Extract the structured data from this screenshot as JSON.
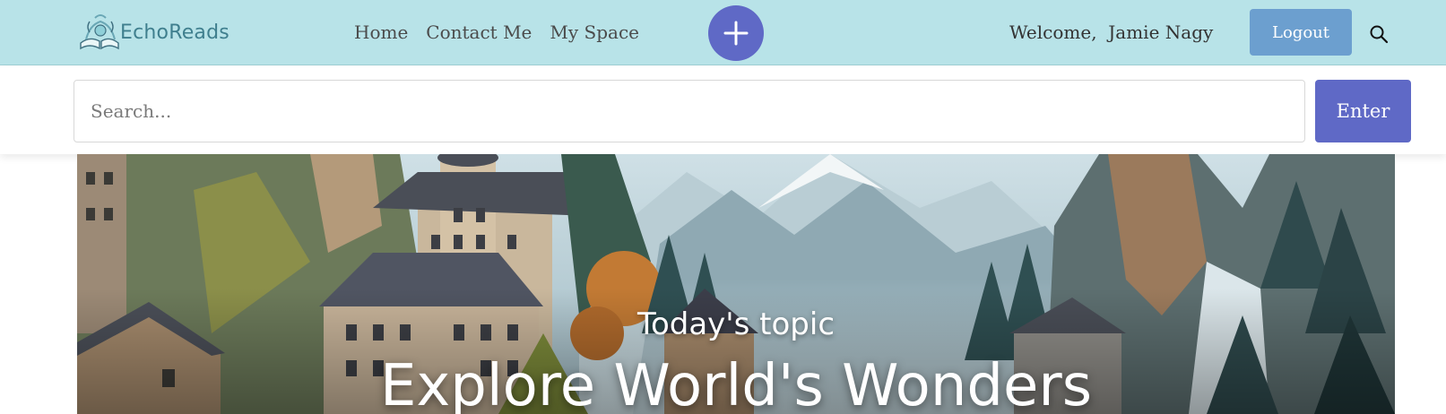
{
  "header": {
    "brand": "EchoReads",
    "nav": [
      {
        "label": "Home"
      },
      {
        "label": "Contact Me"
      },
      {
        "label": "My Space"
      }
    ],
    "add_icon": "plus-icon",
    "welcome_text": "Welcome,  Jamie Nagy",
    "logout_label": "Logout",
    "search_icon": "search-icon"
  },
  "search": {
    "placeholder": "Search...",
    "value": "",
    "enter_label": "Enter"
  },
  "hero": {
    "kicker": "Today's topic",
    "title": "Explore World's Wonders"
  },
  "colors": {
    "header_bg": "#b8e3e8",
    "accent": "#5f69c6",
    "logout_bg": "#6c9fcf"
  }
}
